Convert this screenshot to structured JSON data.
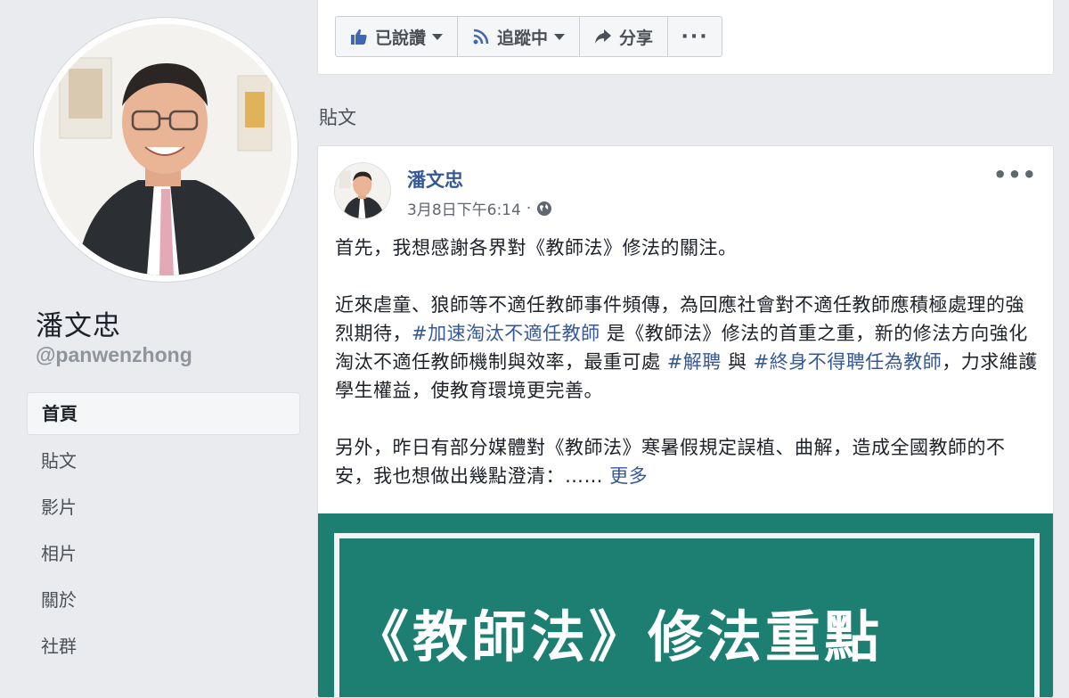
{
  "profile": {
    "name": "潘文忠",
    "handle": "@panwenzhong"
  },
  "nav": {
    "items": [
      {
        "label": "首頁",
        "active": true
      },
      {
        "label": "貼文",
        "active": false
      },
      {
        "label": "影片",
        "active": false
      },
      {
        "label": "相片",
        "active": false
      },
      {
        "label": "關於",
        "active": false
      },
      {
        "label": "社群",
        "active": false
      }
    ]
  },
  "actions": {
    "liked_label": "已說讚",
    "following_label": "追蹤中",
    "share_label": "分享",
    "more_label": "···"
  },
  "section": {
    "title": "貼文"
  },
  "post": {
    "author": "潘文忠",
    "timestamp": "3月8日下午6:14",
    "separator": "·",
    "options_label": "•••",
    "para1": "首先，我想感謝各界對《教師法》修法的關注。",
    "para2_a": "近來虐童、狼師等不適任教師事件頻傳，為回應社會對不適任教師應積極處理的強烈期待，",
    "hashtag1": "#加速淘汰不適任教師",
    "para2_b": " 是《教師法》修法的首重之重，新的修法方向強化淘汰不適任教師機制與效率，最重可處 ",
    "hashtag2": "#解聘",
    "para2_c": " 與 ",
    "hashtag3": "#終身不得聘任為教師",
    "para2_d": "，力求維護學生權益，使教育環境更完善。",
    "para3": "另外，昨日有部分媒體對《教師法》寒暑假規定誤植、曲解，造成全國教師的不安，我也想做出幾點澄清：…… ",
    "see_more": "更多",
    "image_headline": "《教師法》修法重點"
  },
  "colors": {
    "background": "#e9ebee",
    "link": "#365899",
    "image_bg": "#1c7f72"
  }
}
